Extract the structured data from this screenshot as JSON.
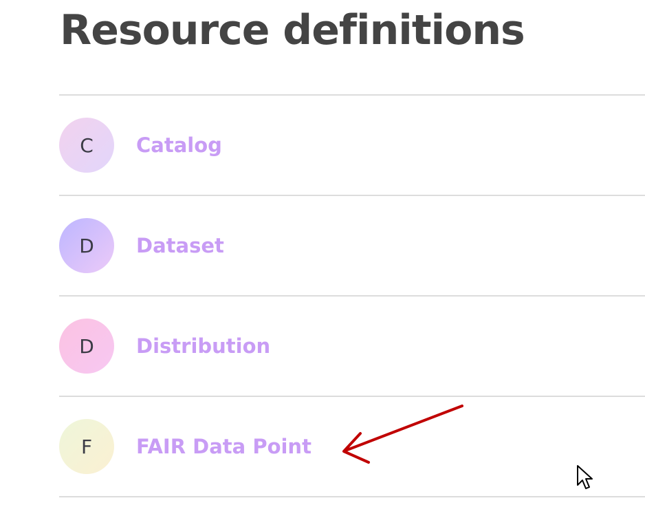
{
  "page": {
    "title": "Resource definitions"
  },
  "resources": [
    {
      "initial": "C",
      "label": "Catalog",
      "avatar_from": "#f2d2ee",
      "avatar_to": "#e2d6fb"
    },
    {
      "initial": "D",
      "label": "Dataset",
      "avatar_from": "#bdb6ff",
      "avatar_to": "#eccaf8"
    },
    {
      "initial": "D",
      "label": "Distribution",
      "avatar_from": "#fbc2e2",
      "avatar_to": "#f7c8f2"
    },
    {
      "initial": "F",
      "label": "FAIR Data Point",
      "avatar_from": "#eef6da",
      "avatar_to": "#fbf0d2"
    }
  ],
  "colors": {
    "title": "#444444",
    "link": "#c89cf5",
    "divider": "#dcdcdc",
    "annotation_arrow": "#c00000"
  },
  "icons": {
    "annotation": "arrow-annotation-icon",
    "cursor": "mouse-pointer-icon"
  }
}
